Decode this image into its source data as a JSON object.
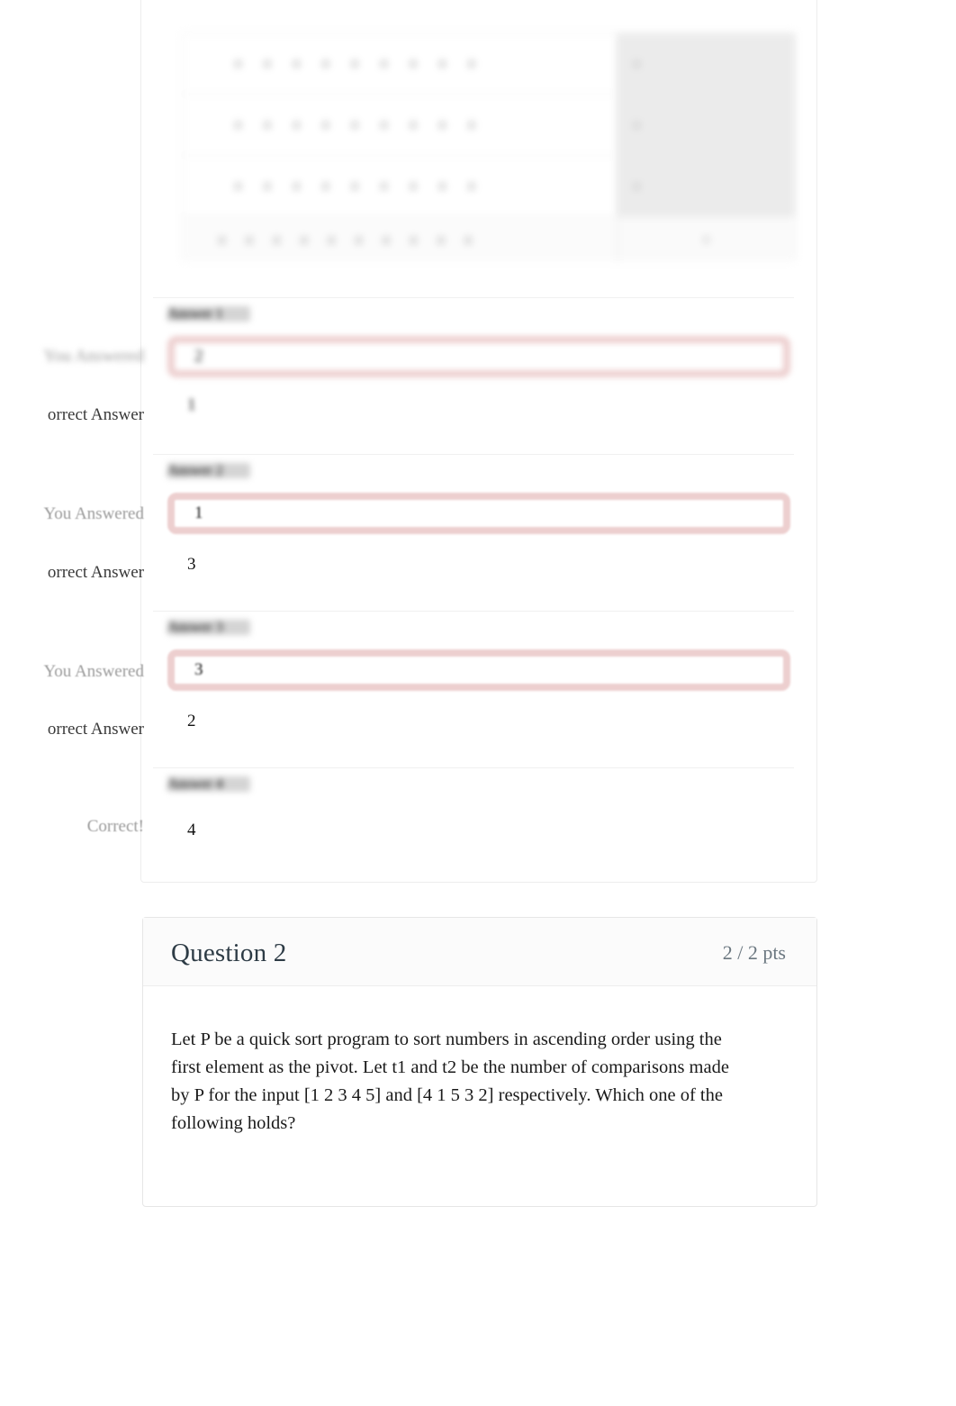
{
  "page": {
    "background": "#ffffff",
    "accent_error": "#edcfcf",
    "text_dark": "#1a1a1a",
    "text_muted": "#9b9b9b"
  },
  "question_1": {
    "matrix_table": {
      "rows": [
        {
          "main": "a a a a a a a a a",
          "side": "a"
        },
        {
          "main": "a a a a a a a a a",
          "side": "a"
        },
        {
          "main": "a a a a a a a a a",
          "side": "a"
        },
        {
          "main": "a a a a a a a a a a",
          "side": "a"
        }
      ]
    },
    "answers": [
      {
        "tag": "Answer 1",
        "you_answered_label": "You Answered",
        "you_answered_value": "2",
        "correct_answer_label": "orrect Answer",
        "correct_answer_value": "1"
      },
      {
        "tag": "Answer 2",
        "you_answered_label": "You Answered",
        "you_answered_value": "1",
        "correct_answer_label": "orrect Answer",
        "correct_answer_value": "3"
      },
      {
        "tag": "Answer 3",
        "you_answered_label": "You Answered",
        "you_answered_value": "3",
        "correct_answer_label": "orrect Answer",
        "correct_answer_value": "2"
      },
      {
        "tag": "Answer 4",
        "correct_label": "Correct!",
        "correct_value": "4"
      }
    ]
  },
  "question_2": {
    "title": "Question 2",
    "points": "2 / 2 pts",
    "text": "Let P be a quick sort program to sort numbers in ascending order using the first element as the pivot. Let t1 and t2 be the number of comparisons made by P for the input [1 2 3 4 5] and [4 1 5 3 2] respectively. Which one of the following holds?"
  }
}
